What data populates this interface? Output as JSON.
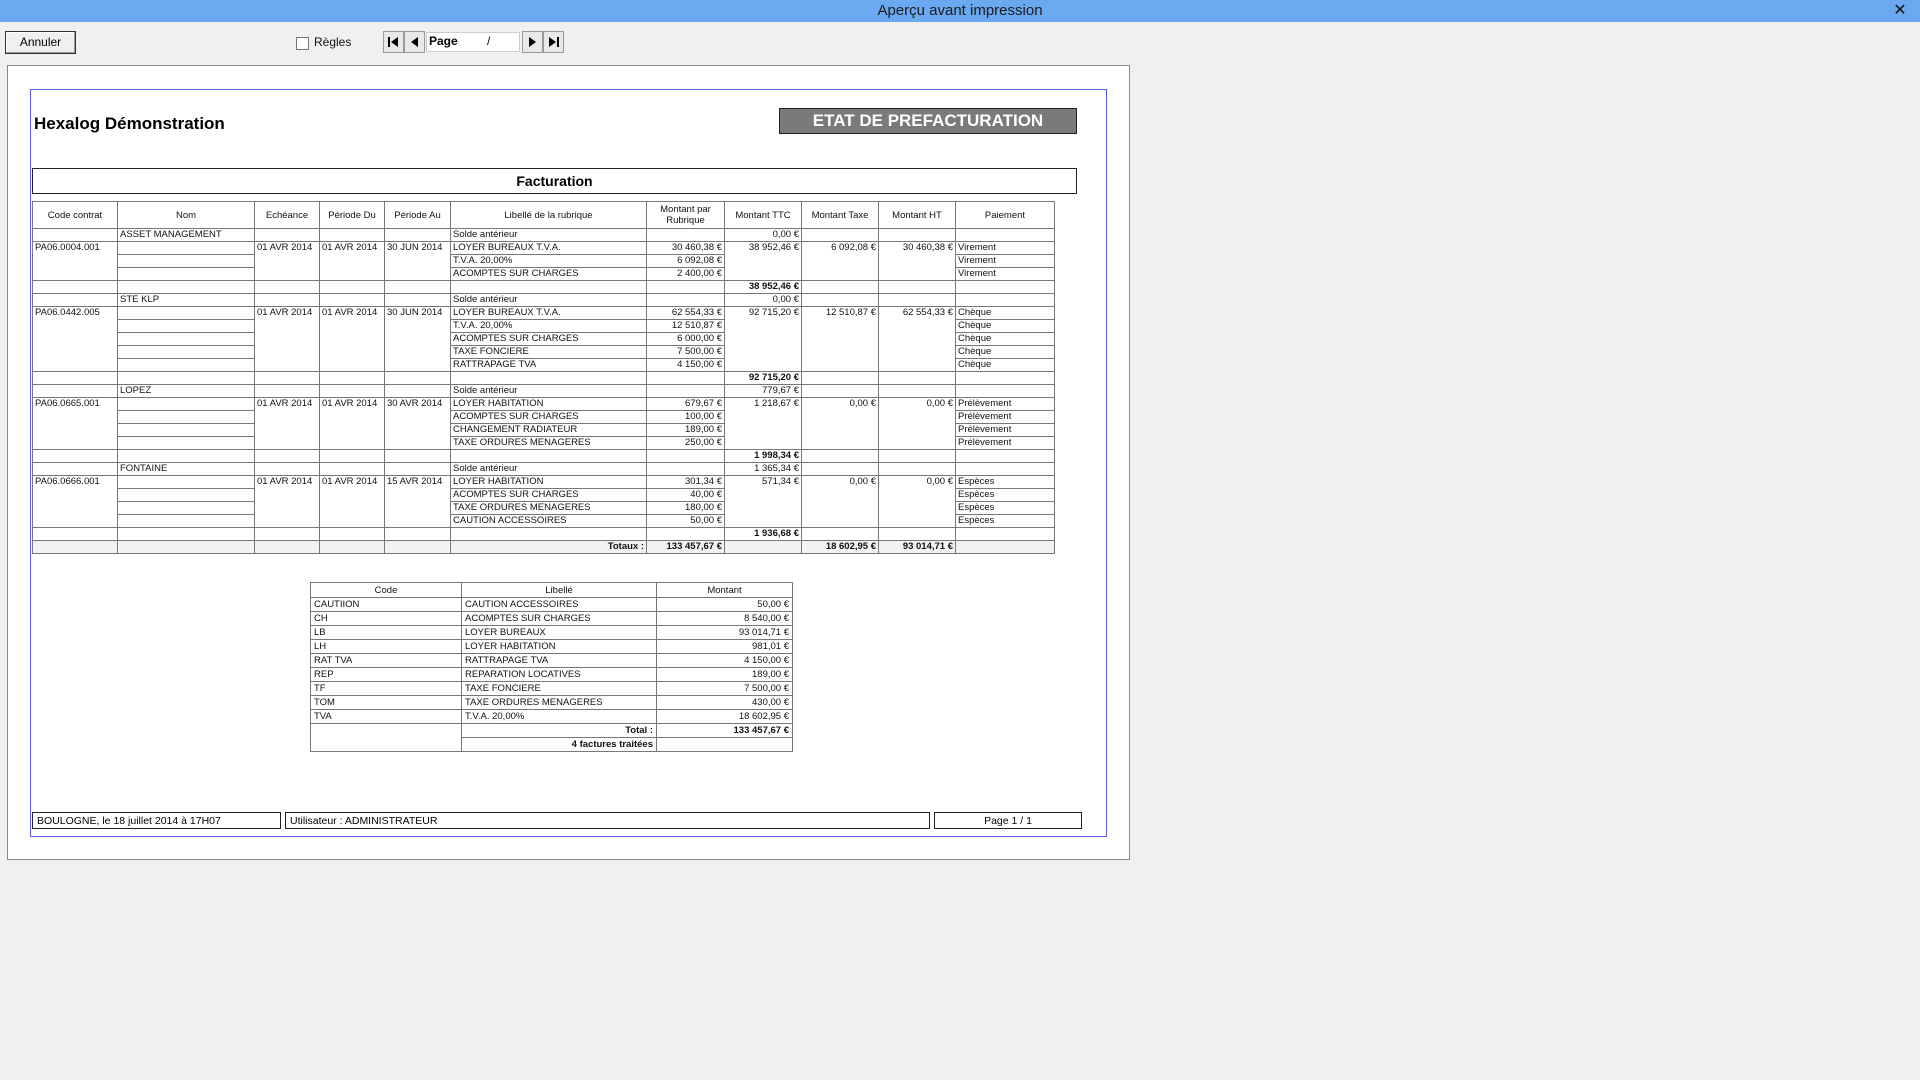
{
  "window": {
    "title": "Aperçu avant impression",
    "close_glyph": "✕"
  },
  "toolbar": {
    "cancel_label": "Annuler",
    "rules_label": "Règles",
    "page_label": "Page",
    "page_sep": "/"
  },
  "report": {
    "company": "Hexalog Démonstration",
    "banner": "ETAT DE PREFACTURATION",
    "section": "Facturation",
    "headers": [
      "Code contrat",
      "Nom",
      "Echéance",
      "Période Du",
      "Période Au",
      "Libellé de la rubrique",
      "Montant par Rubrique",
      "Montant TTC",
      "Montant Taxe",
      "Montant HT",
      "Paiement"
    ],
    "contracts": [
      {
        "code": "PA06.0004.001",
        "name": "ASSET MANAGEMENT",
        "echeance": "01 AVR 2014",
        "du": "01 AVR 2014",
        "au": "30 JUN 2014",
        "solde_label": "Solde antérieur",
        "solde": "0,00 €",
        "ttc": "38 952,46 €",
        "taxe": "6 092,08 €",
        "ht": "30 460,38 €",
        "lines": [
          {
            "lib": "LOYER BUREAUX T.V.A.",
            "mt": "30 460,38 €",
            "pay": "Virement"
          },
          {
            "lib": "T.V.A. 20,00%",
            "mt": "6 092,08 €",
            "pay": "Virement"
          },
          {
            "lib": "ACOMPTES SUR CHARGES",
            "mt": "2 400,00 €",
            "pay": "Virement"
          }
        ],
        "subtotal": "38 952,46 €"
      },
      {
        "code": "PA06.0442.005",
        "name": "STE KLP",
        "echeance": "01 AVR 2014",
        "du": "01 AVR 2014",
        "au": "30 JUN 2014",
        "solde_label": "Solde antérieur",
        "solde": "0,00 €",
        "ttc": "92 715,20 €",
        "taxe": "12 510,87 €",
        "ht": "62 554,33 €",
        "lines": [
          {
            "lib": "LOYER BUREAUX T.V.A.",
            "mt": "62 554,33 €",
            "pay": "Chèque"
          },
          {
            "lib": "T.V.A. 20,00%",
            "mt": "12 510,87 €",
            "pay": "Chèque"
          },
          {
            "lib": "ACOMPTES SUR CHARGES",
            "mt": "6 000,00 €",
            "pay": "Chèque"
          },
          {
            "lib": "TAXE FONCIERE",
            "mt": "7 500,00 €",
            "pay": "Chèque"
          },
          {
            "lib": "RATTRAPAGE TVA",
            "mt": "4 150,00 €",
            "pay": "Chèque"
          }
        ],
        "subtotal": "92 715,20 €"
      },
      {
        "code": "PA06.0665.001",
        "name": "LOPEZ",
        "echeance": "01 AVR 2014",
        "du": "01 AVR 2014",
        "au": "30 AVR 2014",
        "solde_label": "Solde antérieur",
        "solde": "779,67 €",
        "ttc": "1 218,67 €",
        "taxe": "0,00 €",
        "ht": "0,00 €",
        "lines": [
          {
            "lib": "LOYER HABITATION",
            "mt": "679,67 €",
            "pay": "Prélèvement"
          },
          {
            "lib": "ACOMPTES SUR CHARGES",
            "mt": "100,00 €",
            "pay": "Prélèvement"
          },
          {
            "lib": "CHANGEMENT RADIATEUR",
            "mt": "189,00 €",
            "pay": "Prélèvement"
          },
          {
            "lib": "TAXE ORDURES MENAGERES",
            "mt": "250,00 €",
            "pay": "Prélèvement"
          }
        ],
        "subtotal": "1 998,34 €"
      },
      {
        "code": "PA06.0666.001",
        "name": "FONTAINE",
        "echeance": "01 AVR 2014",
        "du": "01 AVR 2014",
        "au": "15 AVR 2014",
        "solde_label": "Solde antérieur",
        "solde": "1 365,34 €",
        "ttc": "571,34 €",
        "taxe": "0,00 €",
        "ht": "0,00 €",
        "lines": [
          {
            "lib": "LOYER HABITATION",
            "mt": "301,34 €",
            "pay": "Espèces"
          },
          {
            "lib": "ACOMPTES SUR CHARGES",
            "mt": "40,00 €",
            "pay": "Espèces"
          },
          {
            "lib": "TAXE ORDURES MENAGERES",
            "mt": "180,00 €",
            "pay": "Espèces"
          },
          {
            "lib": "CAUTION ACCESSOIRES",
            "mt": "50,00 €",
            "pay": "Espèces"
          }
        ],
        "subtotal": "1 936,68 €"
      }
    ],
    "totals": {
      "label": "Totaux :",
      "rubrique": "133 457,67 €",
      "taxe": "18 602,95 €",
      "ht": "93 014,71 €"
    },
    "summary": {
      "headers": [
        "Code",
        "Libellé",
        "Montant"
      ],
      "rows": [
        [
          "CAUTIION",
          "CAUTION ACCESSOIRES",
          "50,00 €"
        ],
        [
          "CH",
          "ACOMPTES SUR CHARGES",
          "8 540,00 €"
        ],
        [
          "LB",
          "LOYER BUREAUX",
          "93 014,71 €"
        ],
        [
          "LH",
          "LOYER HABITATION",
          "981,01 €"
        ],
        [
          "RAT TVA",
          "RATTRAPAGE TVA",
          "4 150,00 €"
        ],
        [
          "REP",
          "REPARATION LOCATIVES",
          "189,00 €"
        ],
        [
          "TF",
          "TAXE FONCIERE",
          "7 500,00 €"
        ],
        [
          "TOM",
          "TAXE ORDURES MENAGERES",
          "430,00 €"
        ],
        [
          "TVA",
          "T.V.A. 20,00%",
          "18 602,95 €"
        ]
      ],
      "total_label": "Total :",
      "total": "133 457,67 €",
      "count_label": "4 factures traitées"
    },
    "footer": {
      "place_date": "BOULOGNE, le 18 juillet 2014  à 17H07",
      "user": "Utilisateur : ADMINISTRATEUR",
      "page": "Page 1 / 1"
    }
  }
}
